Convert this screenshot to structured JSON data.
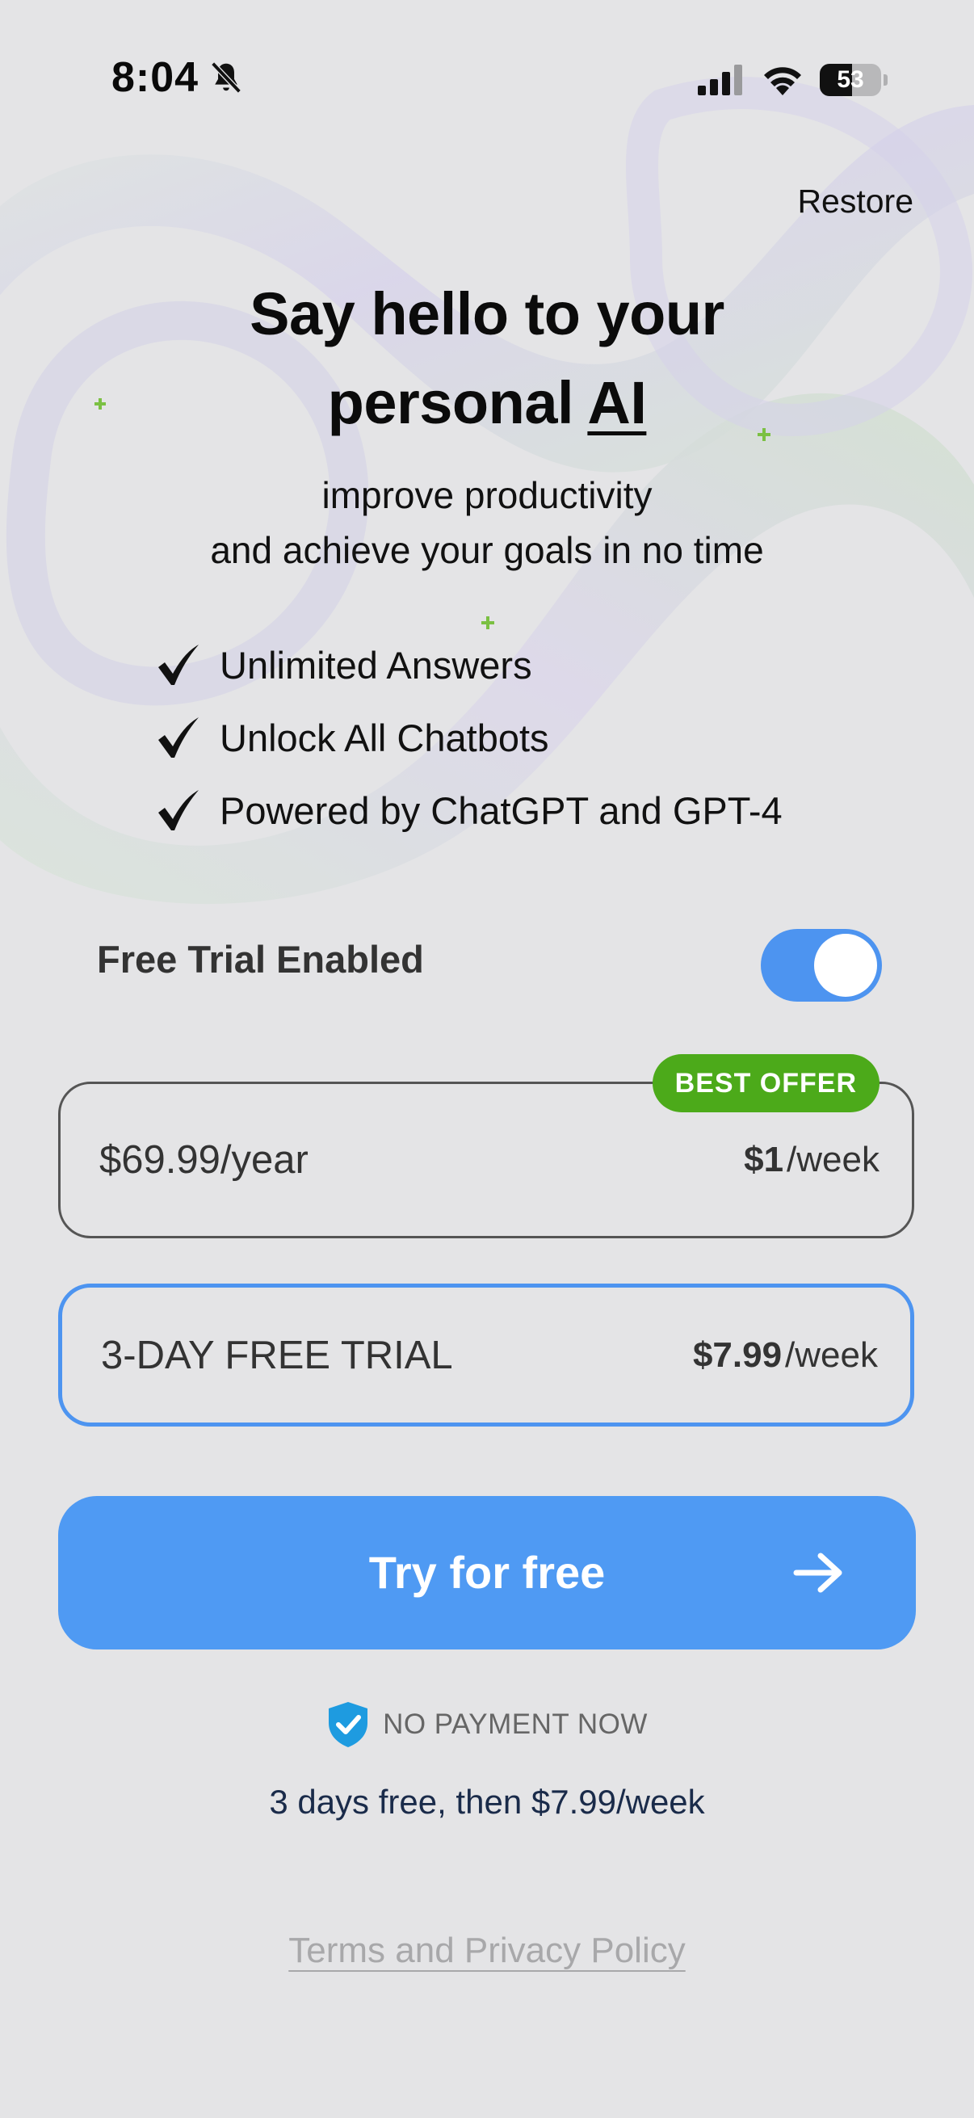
{
  "status_bar": {
    "time": "8:04",
    "battery_level": 53,
    "battery_text": "53"
  },
  "header": {
    "restore_label": "Restore"
  },
  "hero": {
    "headline_line1": "Say hello to your",
    "headline_line2_prefix": "personal ",
    "headline_line2_emphasis": "AI",
    "subhead_line1": "improve productivity",
    "subhead_line2": "and achieve your goals in no time"
  },
  "features": [
    {
      "label": "Unlimited Answers"
    },
    {
      "label": "Unlock All Chatbots"
    },
    {
      "label": "Powered by ChatGPT and GPT-4"
    }
  ],
  "free_trial": {
    "label": "Free Trial Enabled",
    "enabled": true
  },
  "plans": {
    "yearly": {
      "badge": "BEST OFFER",
      "price": "$69.99/year",
      "per_week_amount": "$1",
      "per_week_suffix": " /week"
    },
    "trial": {
      "label": "3-DAY FREE TRIAL",
      "per_week_amount": "$7.99",
      "per_week_suffix": "/week",
      "selected": true
    }
  },
  "cta": {
    "label": "Try for free"
  },
  "footer": {
    "no_payment": "NO PAYMENT NOW",
    "pricing_note": "3 days free, then $7.99/week",
    "terms_link": "Terms and Privacy Policy"
  },
  "colors": {
    "accent_blue": "#4f9af3",
    "badge_green": "#4caa1a",
    "background": "#e4e4e6",
    "shield_blue": "#1e9be0",
    "sparkle_green": "#7bc043"
  },
  "icons": [
    "bell-slash-icon",
    "signal-icon",
    "wifi-icon",
    "battery-icon",
    "check-icon",
    "arrow-right-icon",
    "shield-check-icon",
    "sparkle-icon"
  ]
}
